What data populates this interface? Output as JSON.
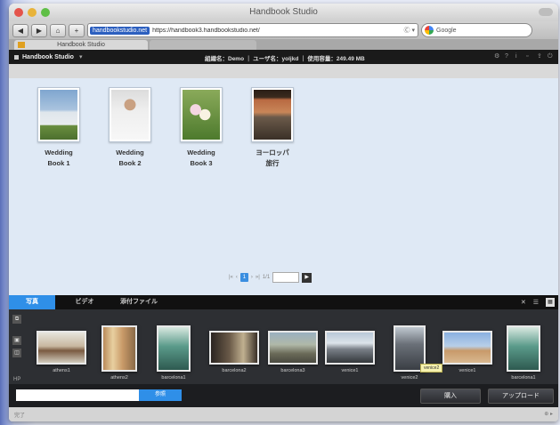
{
  "window": {
    "title": "Handbook Studio"
  },
  "toolbar": {
    "back": "◀",
    "forward": "▶",
    "home": "⌂",
    "add": "+",
    "url_host": "handbookstudio.net",
    "url": "https://handbook3.handbookstudio.net/",
    "url_end": "Ⓒ ▾",
    "search_placeholder": "Google"
  },
  "tabs": [
    {
      "label": "Handbook Studio"
    }
  ],
  "app_header": {
    "name": "Handbook Studio",
    "dropdown": "▾",
    "user_info": "組織名：Demo ｜ ユーザ名：yoljkd ｜ 使用容量：249.49 MB"
  },
  "books": [
    {
      "title": "Wedding\nBook 1"
    },
    {
      "title": "Wedding\nBook 2"
    },
    {
      "title": "Wedding\nBook 3"
    },
    {
      "title": "ヨーロッパ\n旅行"
    }
  ],
  "pager": {
    "first": "|«",
    "prev": "‹",
    "current": "1",
    "next": "›",
    "last": "»|",
    "of": "1/1",
    "go": "▶"
  },
  "bottom_tabs": [
    {
      "label": "写真"
    },
    {
      "label": "ビデオ"
    },
    {
      "label": "添付ファイル"
    }
  ],
  "bottom_controls": {
    "close": "✕",
    "list": "☰",
    "grid": "▦"
  },
  "side_buttons": [
    "⧉",
    "▣",
    "◫"
  ],
  "side_label": "HP",
  "strip_items": [
    {
      "caption": "athens1"
    },
    {
      "caption": "athens2"
    },
    {
      "caption": "barcelona1"
    },
    {
      "caption": "barcelona2"
    },
    {
      "caption": "barcelona3"
    },
    {
      "caption": "venice1"
    },
    {
      "caption": "venice2"
    },
    {
      "caption": "venice1"
    },
    {
      "caption": "barcelona1"
    }
  ],
  "tooltip": "venice2",
  "footer": {
    "select_label": "参照",
    "buy_label": "購入",
    "upload_label": "アップロード"
  },
  "status": {
    "left": "完了",
    "right": "⊕ ▸"
  }
}
